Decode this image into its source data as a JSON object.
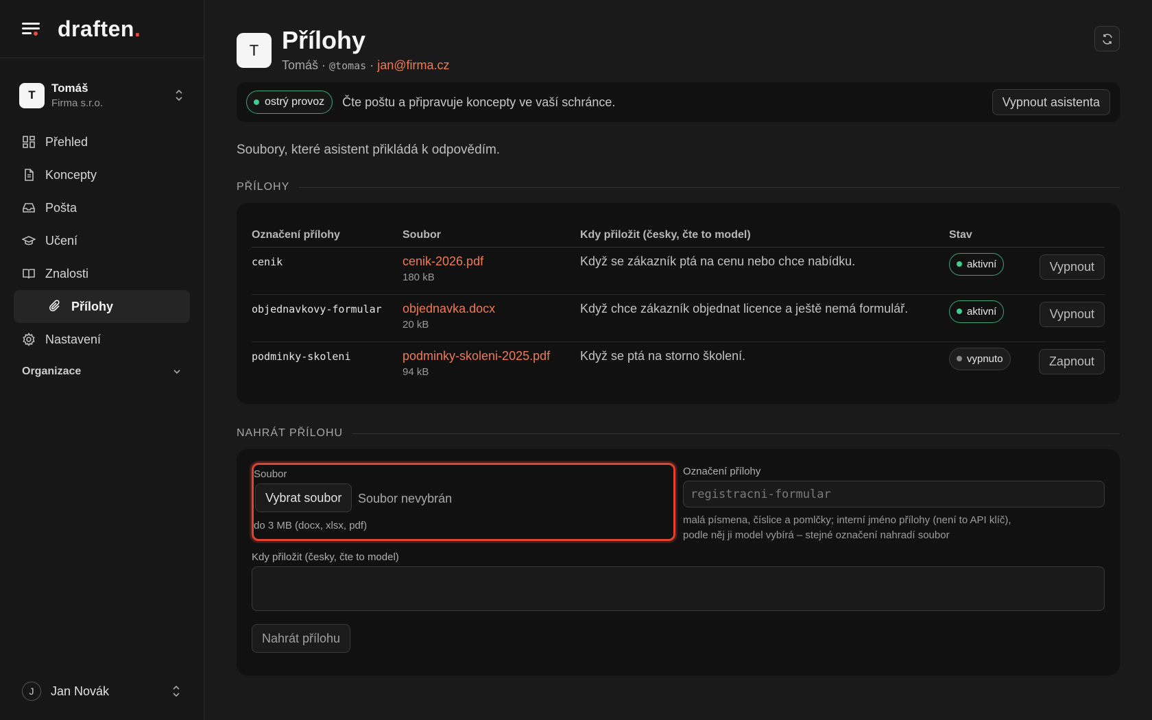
{
  "brand": {
    "name": "draften",
    "dot": "."
  },
  "account": {
    "initial": "T",
    "name": "Tomáš",
    "org": "Firma s.r.o."
  },
  "nav": {
    "items": [
      {
        "label": "Přehled",
        "icon": "grid-icon"
      },
      {
        "label": "Koncepty",
        "icon": "document-icon"
      },
      {
        "label": "Pošta",
        "icon": "inbox-icon"
      },
      {
        "label": "Učení",
        "icon": "graduation-cap-icon"
      },
      {
        "label": "Znalosti",
        "icon": "book-icon"
      }
    ],
    "sub_active": {
      "label": "Přílohy",
      "icon": "paperclip-icon"
    },
    "settings": {
      "label": "Nastavení",
      "icon": "gear-icon"
    },
    "org_section": "Organizace"
  },
  "user": {
    "initial": "J",
    "name": "Jan Novák"
  },
  "header": {
    "avatar_initial": "T",
    "title": "Přílohy",
    "name": "Tomáš",
    "sep1": " · ",
    "handle": "@tomas",
    "sep2": " · ",
    "email": "jan@firma.cz"
  },
  "status": {
    "pill": "ostrý provoz",
    "text": "Čte poštu a připravuje koncepty ve vaší schránce.",
    "button": "Vypnout asistenta"
  },
  "intro": "Soubory, které asistent přikládá k odpovědím.",
  "attachments": {
    "section_label": "PŘÍLOHY",
    "columns": [
      "Označení přílohy",
      "Soubor",
      "Kdy přiložit (česky, čte to model)",
      "Stav"
    ],
    "rows": [
      {
        "ident": "cenik",
        "file": "cenik-2026.pdf",
        "size": "180 kB",
        "when": "Když se zákazník ptá na cenu nebo chce nabídku.",
        "state": "aktivní",
        "action": "Vypnout"
      },
      {
        "ident": "objednavkovy-formular",
        "file": "objednavka.docx",
        "size": "20 kB",
        "when": "Když chce zákazník objednat licence a ještě nemá formulář.",
        "state": "aktivní",
        "action": "Vypnout"
      },
      {
        "ident": "podminky-skoleni",
        "file": "podminky-skoleni-2025.pdf",
        "size": "94 kB",
        "when": "Když se ptá na storno školení.",
        "state": "vypnuto",
        "action": "Zapnout"
      }
    ]
  },
  "upload": {
    "section_label": "NAHRÁT PŘÍLOHU",
    "file_label": "Soubor",
    "choose_button": "Vybrat soubor",
    "no_file": "Soubor nevybrán",
    "file_hint": "do 3 MB (docx, xlsx, pdf)",
    "ident_label": "Označení přílohy",
    "ident_placeholder": "registracni-formular",
    "ident_help_1": "malá písmena, číslice a pomlčky; interní jméno přílohy (není to API klíč),",
    "ident_help_2": "podle něj ji model vybírá – stejné označení nahradí soubor",
    "when_label": "Kdy přiložit (česky, čte to model)",
    "submit": "Nahrát přílohu"
  },
  "colors": {
    "accent": "#ef7a57",
    "brand_dot": "#e84b3a",
    "active": "#3fce8e",
    "highlight": "#e2432f"
  }
}
